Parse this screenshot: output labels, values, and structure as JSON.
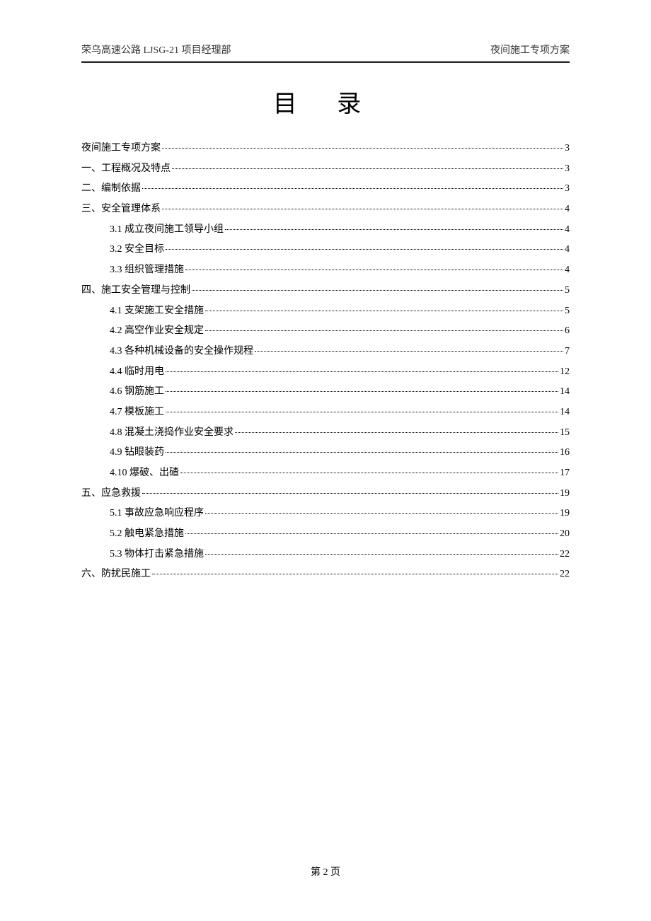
{
  "header": {
    "left": "荣乌高速公路 LJSG-21 项目经理部",
    "right": "夜间施工专项方案"
  },
  "title": "目 录",
  "toc": [
    {
      "label": "夜间施工专项方案",
      "page": "3",
      "level": 0
    },
    {
      "label": "一、工程概况及特点",
      "page": "3",
      "level": 0
    },
    {
      "label": "二、编制依据",
      "page": "3",
      "level": 0
    },
    {
      "label": "三、安全管理体系",
      "page": "4",
      "level": 0
    },
    {
      "label": "3.1 成立夜间施工领导小组",
      "page": "4",
      "level": 1
    },
    {
      "label": "3.2 安全目标",
      "page": "4",
      "level": 1
    },
    {
      "label": "3.3 组织管理措施",
      "page": "4",
      "level": 1
    },
    {
      "label": "四、施工安全管理与控制",
      "page": "5",
      "level": 0
    },
    {
      "label": "4.1 支架施工安全措施",
      "page": "5",
      "level": 1
    },
    {
      "label": "4.2 高空作业安全规定",
      "page": "6",
      "level": 1
    },
    {
      "label": "4.3 各种机械设备的安全操作规程",
      "page": "7",
      "level": 1
    },
    {
      "label": "4.4 临时用电",
      "page": "12",
      "level": 1
    },
    {
      "label": "4.6 钢筋施工",
      "page": "14",
      "level": 1
    },
    {
      "label": "4.7 模板施工",
      "page": "14",
      "level": 1
    },
    {
      "label": "4.8 混凝土浇捣作业安全要求",
      "page": "15",
      "level": 1
    },
    {
      "label": "4.9 钻眼装药",
      "page": "16",
      "level": 1
    },
    {
      "label": "4.10 爆破、出碴",
      "page": "17",
      "level": 1
    },
    {
      "label": "五、应急救援",
      "page": "19",
      "level": 0
    },
    {
      "label": "5.1 事故应急响应程序",
      "page": "19",
      "level": 1
    },
    {
      "label": "5.2 触电紧急措施",
      "page": "20",
      "level": 1
    },
    {
      "label": "5.3 物体打击紧急措施",
      "page": "22",
      "level": 1
    },
    {
      "label": "六、防扰民施工",
      "page": "22",
      "level": 0
    }
  ],
  "footer": "第 2 页"
}
